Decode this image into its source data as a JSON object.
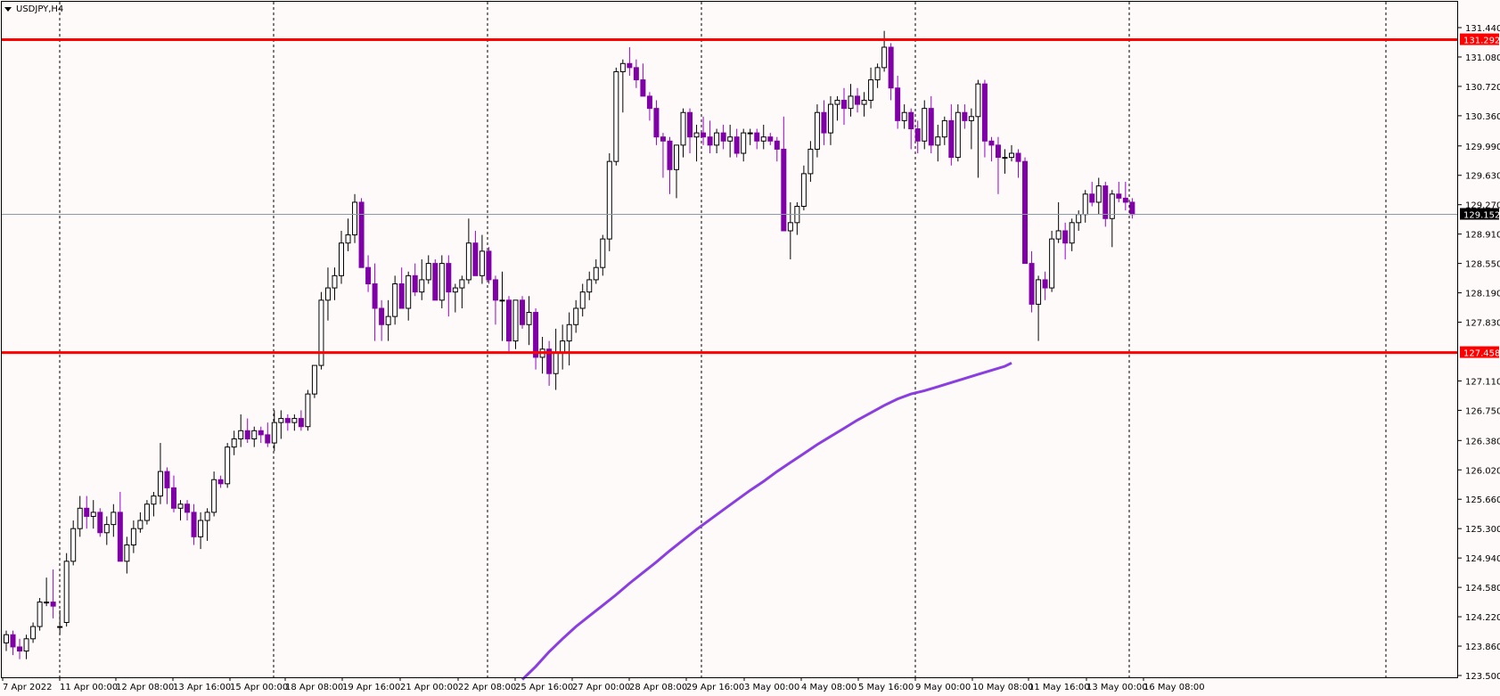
{
  "window": {
    "title": "USDJPY,H4",
    "menu_icon": "triangle-down-icon"
  },
  "colors": {
    "background": "#fffafa",
    "bull_body": "#ffffff",
    "bear_body": "#8000a8",
    "wick_bull": "#000000",
    "wick_bear": "#9900cc",
    "level_line": "#ff0000",
    "level_tag_bg": "#ff0000",
    "current_line": "#8c9aa8",
    "current_tag_bg": "#000000",
    "ma_line": "#8a3ee0",
    "grid": "#000000"
  },
  "chart_data": {
    "type": "candlestick",
    "symbol": "USDJPY",
    "timeframe": "H4",
    "title": "USDJPY,H4",
    "ylim": [
      123.5,
      131.6
    ],
    "y_ticks": [
      "131.440",
      "131.080",
      "130.720",
      "130.360",
      "129.990",
      "129.630",
      "129.270",
      "128.910",
      "128.550",
      "128.190",
      "127.830",
      "127.110",
      "126.750",
      "126.380",
      "126.020",
      "125.660",
      "125.300",
      "124.940",
      "124.580",
      "124.220",
      "123.860",
      "123.500"
    ],
    "x_ticks": [
      "7 Apr 2022",
      "11 Apr 00:00",
      "12 Apr 08:00",
      "13 Apr 16:00",
      "15 Apr 00:00",
      "18 Apr 08:00",
      "19 Apr 16:00",
      "21 Apr 00:00",
      "22 Apr 08:00",
      "25 Apr 16:00",
      "27 Apr 00:00",
      "28 Apr 08:00",
      "29 Apr 16:00",
      "3 May 00:00",
      "4 May 08:00",
      "5 May 16:00",
      "9 May 00:00",
      "10 May 08:00",
      "11 May 16:00",
      "13 May 00:00",
      "16 May 08:00"
    ],
    "grid": "vertical dashed at day separators",
    "levels": [
      {
        "name": "resistance",
        "value": 131.292,
        "label": "131.292"
      },
      {
        "name": "support",
        "value": 127.458,
        "label": "127.458"
      }
    ],
    "current_price": {
      "value": 129.152,
      "label": "129.152"
    },
    "moving_average": [
      [
        77,
        123.45
      ],
      [
        79,
        123.61
      ],
      [
        81,
        123.79
      ],
      [
        83,
        123.95
      ],
      [
        85,
        124.1
      ],
      [
        87,
        124.23
      ],
      [
        89,
        124.36
      ],
      [
        91,
        124.49
      ],
      [
        93,
        124.63
      ],
      [
        95,
        124.76
      ],
      [
        97,
        124.89
      ],
      [
        99,
        125.03
      ],
      [
        101,
        125.16
      ],
      [
        103,
        125.29
      ],
      [
        105,
        125.41
      ],
      [
        107,
        125.53
      ],
      [
        109,
        125.65
      ],
      [
        111,
        125.77
      ],
      [
        113,
        125.88
      ],
      [
        115,
        126.0
      ],
      [
        117,
        126.11
      ],
      [
        119,
        126.22
      ],
      [
        121,
        126.33
      ],
      [
        123,
        126.43
      ],
      [
        125,
        126.53
      ],
      [
        127,
        126.63
      ],
      [
        129,
        126.72
      ],
      [
        131,
        126.81
      ],
      [
        133,
        126.89
      ],
      [
        135,
        126.95
      ],
      [
        137,
        126.99
      ],
      [
        139,
        127.04
      ],
      [
        141,
        127.09
      ],
      [
        143,
        127.14
      ],
      [
        145,
        127.19
      ],
      [
        147,
        127.24
      ],
      [
        149,
        127.29
      ],
      [
        150,
        127.33
      ]
    ],
    "candles": [
      [
        123.9,
        124.05,
        123.8,
        124.0
      ],
      [
        124.0,
        124.05,
        123.75,
        123.85
      ],
      [
        123.85,
        123.95,
        123.7,
        123.8
      ],
      [
        123.8,
        124.0,
        123.7,
        123.95
      ],
      [
        123.95,
        124.15,
        123.9,
        124.1
      ],
      [
        124.1,
        124.45,
        124.05,
        124.4
      ],
      [
        124.4,
        124.7,
        124.35,
        124.4
      ],
      [
        124.4,
        124.8,
        124.2,
        124.35
      ],
      [
        124.1,
        124.3,
        124.0,
        124.1
      ],
      [
        124.15,
        125.0,
        124.1,
        124.9
      ],
      [
        124.9,
        125.4,
        124.85,
        125.3
      ],
      [
        125.3,
        125.7,
        125.2,
        125.55
      ],
      [
        125.55,
        125.7,
        125.3,
        125.45
      ],
      [
        125.45,
        125.65,
        125.3,
        125.5
      ],
      [
        125.5,
        125.55,
        125.2,
        125.25
      ],
      [
        125.25,
        125.45,
        125.1,
        125.35
      ],
      [
        125.35,
        125.6,
        125.2,
        125.5
      ],
      [
        125.5,
        125.75,
        125.2,
        124.9
      ],
      [
        124.9,
        125.2,
        124.75,
        125.1
      ],
      [
        125.1,
        125.4,
        125.0,
        125.3
      ],
      [
        125.3,
        125.5,
        125.25,
        125.4
      ],
      [
        125.4,
        125.65,
        125.35,
        125.6
      ],
      [
        125.6,
        125.75,
        125.45,
        125.7
      ],
      [
        125.7,
        126.35,
        125.6,
        126.0
      ],
      [
        126.0,
        126.05,
        125.6,
        125.8
      ],
      [
        125.8,
        125.95,
        125.5,
        125.55
      ],
      [
        125.55,
        125.65,
        125.4,
        125.6
      ],
      [
        125.6,
        125.65,
        125.4,
        125.5
      ],
      [
        125.5,
        125.6,
        125.1,
        125.2
      ],
      [
        125.2,
        125.5,
        125.05,
        125.4
      ],
      [
        125.4,
        125.55,
        125.15,
        125.5
      ],
      [
        125.5,
        126.0,
        125.45,
        125.9
      ],
      [
        125.9,
        125.95,
        125.8,
        125.85
      ],
      [
        125.85,
        126.35,
        125.8,
        126.3
      ],
      [
        126.3,
        126.5,
        126.2,
        126.4
      ],
      [
        126.4,
        126.7,
        126.3,
        126.5
      ],
      [
        126.5,
        126.65,
        126.35,
        126.4
      ],
      [
        126.4,
        126.55,
        126.3,
        126.5
      ],
      [
        126.5,
        126.55,
        126.35,
        126.45
      ],
      [
        126.45,
        126.6,
        126.3,
        126.35
      ],
      [
        126.35,
        126.75,
        126.25,
        126.6
      ],
      [
        126.6,
        126.75,
        126.4,
        126.65
      ],
      [
        126.65,
        126.7,
        126.5,
        126.6
      ],
      [
        126.6,
        126.7,
        126.5,
        126.65
      ],
      [
        126.65,
        126.75,
        126.5,
        126.55
      ],
      [
        126.55,
        127.0,
        126.5,
        126.95
      ],
      [
        126.95,
        127.3,
        126.9,
        127.3
      ],
      [
        127.3,
        128.2,
        127.25,
        128.1
      ],
      [
        128.1,
        128.5,
        127.85,
        128.25
      ],
      [
        128.25,
        128.5,
        128.1,
        128.4
      ],
      [
        128.4,
        128.95,
        128.3,
        128.8
      ],
      [
        128.8,
        129.1,
        128.7,
        128.9
      ],
      [
        128.9,
        129.4,
        128.8,
        129.3
      ],
      [
        129.3,
        129.35,
        128.7,
        128.5
      ],
      [
        128.5,
        128.65,
        128.2,
        128.3
      ],
      [
        128.3,
        128.55,
        127.6,
        128.0
      ],
      [
        128.0,
        128.1,
        127.6,
        127.8
      ],
      [
        127.8,
        128.1,
        127.6,
        127.9
      ],
      [
        127.9,
        128.4,
        127.8,
        128.3
      ],
      [
        128.3,
        128.5,
        128.0,
        128.0
      ],
      [
        128.0,
        128.45,
        127.85,
        128.4
      ],
      [
        128.4,
        128.55,
        128.15,
        128.2
      ],
      [
        128.2,
        128.6,
        128.1,
        128.35
      ],
      [
        128.35,
        128.65,
        128.3,
        128.55
      ],
      [
        128.55,
        128.6,
        128.1,
        128.1
      ],
      [
        128.1,
        128.65,
        128.0,
        128.55
      ],
      [
        128.55,
        128.65,
        127.9,
        128.2
      ],
      [
        128.2,
        128.3,
        127.95,
        128.25
      ],
      [
        128.25,
        128.4,
        128.0,
        128.35
      ],
      [
        128.35,
        129.1,
        128.3,
        128.8
      ],
      [
        128.8,
        128.95,
        128.45,
        128.4
      ],
      [
        128.4,
        128.9,
        128.3,
        128.7
      ],
      [
        128.7,
        128.75,
        128.3,
        128.35
      ],
      [
        128.35,
        128.4,
        127.8,
        128.1
      ],
      [
        128.1,
        128.45,
        127.6,
        128.1
      ],
      [
        128.1,
        128.15,
        127.45,
        127.6
      ],
      [
        127.6,
        128.1,
        127.5,
        128.1
      ],
      [
        128.1,
        128.15,
        127.75,
        127.8
      ],
      [
        127.8,
        128.15,
        127.55,
        127.95
      ],
      [
        127.95,
        128.0,
        127.25,
        127.4
      ],
      [
        127.4,
        127.65,
        127.2,
        127.5
      ],
      [
        127.5,
        127.6,
        127.05,
        127.2
      ],
      [
        127.2,
        127.75,
        127.0,
        127.45
      ],
      [
        127.45,
        127.8,
        127.25,
        127.6
      ],
      [
        127.6,
        127.95,
        127.3,
        127.8
      ],
      [
        127.8,
        128.1,
        127.7,
        128.0
      ],
      [
        128.0,
        128.3,
        127.9,
        128.2
      ],
      [
        128.2,
        128.45,
        128.1,
        128.35
      ],
      [
        128.35,
        128.6,
        128.3,
        128.5
      ],
      [
        128.5,
        128.9,
        128.4,
        128.85
      ],
      [
        128.85,
        129.9,
        128.7,
        129.8
      ],
      [
        129.8,
        130.95,
        129.75,
        130.9
      ],
      [
        130.9,
        131.05,
        130.4,
        131.0
      ],
      [
        131.0,
        131.2,
        130.85,
        130.95
      ],
      [
        130.95,
        131.05,
        130.7,
        130.8
      ],
      [
        130.8,
        131.0,
        130.6,
        130.6
      ],
      [
        130.6,
        130.65,
        130.3,
        130.45
      ],
      [
        130.45,
        130.55,
        130.0,
        130.1
      ],
      [
        130.1,
        130.15,
        129.6,
        130.05
      ],
      [
        130.05,
        130.1,
        129.4,
        129.7
      ],
      [
        129.7,
        130.0,
        129.35,
        130.0
      ],
      [
        130.0,
        130.45,
        129.85,
        130.4
      ],
      [
        130.4,
        130.45,
        129.9,
        130.1
      ],
      [
        130.1,
        130.25,
        129.8,
        130.15
      ],
      [
        130.15,
        130.35,
        130.0,
        130.1
      ],
      [
        130.1,
        130.3,
        129.9,
        130.0
      ],
      [
        130.0,
        130.2,
        129.9,
        130.15
      ],
      [
        130.15,
        130.25,
        129.95,
        130.05
      ],
      [
        130.05,
        130.25,
        129.85,
        130.1
      ],
      [
        130.1,
        130.2,
        129.85,
        129.9
      ],
      [
        129.9,
        130.2,
        129.8,
        130.15
      ],
      [
        130.15,
        130.2,
        130.0,
        130.15
      ],
      [
        130.15,
        130.2,
        129.95,
        130.05
      ],
      [
        130.05,
        130.25,
        129.95,
        130.1
      ],
      [
        130.1,
        130.15,
        130.0,
        130.05
      ],
      [
        130.05,
        130.1,
        129.8,
        129.95
      ],
      [
        129.95,
        130.35,
        129.3,
        128.95
      ],
      [
        128.95,
        129.3,
        128.6,
        129.05
      ],
      [
        129.05,
        129.3,
        128.9,
        129.25
      ],
      [
        129.25,
        129.75,
        129.2,
        129.65
      ],
      [
        129.65,
        130.05,
        129.55,
        129.95
      ],
      [
        129.95,
        130.5,
        129.85,
        130.4
      ],
      [
        130.4,
        130.55,
        130.0,
        130.15
      ],
      [
        130.15,
        130.6,
        130.0,
        130.5
      ],
      [
        130.5,
        130.6,
        130.3,
        130.55
      ],
      [
        130.55,
        130.7,
        130.25,
        130.45
      ],
      [
        130.45,
        130.75,
        130.35,
        130.6
      ],
      [
        130.6,
        130.7,
        130.4,
        130.5
      ],
      [
        130.5,
        130.65,
        130.35,
        130.55
      ],
      [
        130.55,
        130.95,
        130.45,
        130.8
      ],
      [
        130.8,
        131.0,
        130.7,
        130.95
      ],
      [
        130.95,
        131.4,
        130.9,
        131.2
      ],
      [
        131.2,
        131.25,
        130.55,
        130.7
      ],
      [
        130.7,
        130.85,
        130.2,
        130.3
      ],
      [
        130.3,
        130.5,
        130.2,
        130.4
      ],
      [
        130.4,
        130.45,
        129.95,
        130.2
      ],
      [
        130.2,
        130.3,
        129.9,
        130.05
      ],
      [
        130.05,
        130.55,
        129.95,
        130.45
      ],
      [
        130.45,
        130.6,
        129.9,
        130.0
      ],
      [
        130.0,
        130.25,
        129.8,
        130.1
      ],
      [
        130.1,
        130.35,
        130.0,
        130.3
      ],
      [
        130.3,
        130.5,
        129.75,
        129.85
      ],
      [
        129.85,
        130.5,
        129.8,
        130.4
      ],
      [
        130.4,
        130.5,
        130.2,
        130.3
      ],
      [
        130.3,
        130.45,
        129.95,
        130.35
      ],
      [
        130.35,
        130.8,
        129.6,
        130.75
      ],
      [
        130.75,
        130.8,
        129.85,
        130.05
      ],
      [
        130.05,
        130.1,
        129.8,
        130.0
      ],
      [
        130.0,
        130.1,
        129.4,
        129.85
      ],
      [
        129.85,
        129.95,
        129.65,
        129.85
      ],
      [
        129.85,
        130.0,
        129.8,
        129.9
      ],
      [
        129.9,
        129.95,
        129.6,
        129.8
      ],
      [
        129.8,
        129.85,
        128.9,
        128.55
      ],
      [
        128.55,
        128.7,
        127.95,
        128.05
      ],
      [
        128.05,
        128.4,
        127.6,
        128.35
      ],
      [
        128.35,
        128.45,
        128.1,
        128.25
      ],
      [
        128.25,
        128.95,
        128.2,
        128.85
      ],
      [
        128.85,
        129.3,
        128.8,
        128.95
      ],
      [
        128.95,
        129.05,
        128.6,
        128.8
      ],
      [
        128.8,
        129.1,
        128.7,
        129.05
      ],
      [
        129.05,
        129.2,
        128.95,
        129.15
      ],
      [
        129.15,
        129.45,
        129.05,
        129.4
      ],
      [
        129.4,
        129.55,
        129.25,
        129.3
      ],
      [
        129.3,
        129.6,
        129.15,
        129.5
      ],
      [
        129.5,
        129.55,
        129.0,
        129.1
      ],
      [
        129.1,
        129.45,
        128.75,
        129.4
      ],
      [
        129.4,
        129.55,
        129.3,
        129.35
      ],
      [
        129.35,
        129.55,
        129.2,
        129.3
      ],
      [
        129.3,
        129.35,
        129.1,
        129.15
      ]
    ]
  }
}
